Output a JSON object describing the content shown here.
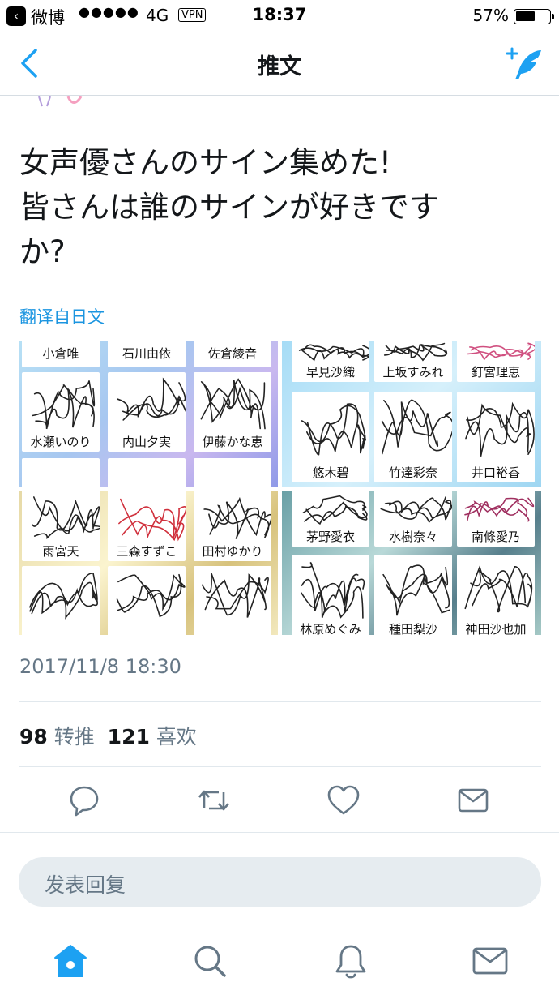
{
  "status_bar": {
    "app_name": "微博",
    "signal": "●●●●●",
    "network": "4G",
    "vpn": "VPN",
    "time": "18:37",
    "battery_percent": "57%",
    "battery_level": 0.57
  },
  "nav": {
    "title": "推文"
  },
  "tweet": {
    "text_lines": [
      "女声優さんのサイン集めた!",
      "皆さんは誰のサインが好きです",
      "か?"
    ],
    "translate_link": "翻译自日文",
    "timestamp": "2017/11/8 18:30",
    "retweet_count": "98",
    "retweet_label": "转推",
    "like_count": "121",
    "like_label": "喜欢"
  },
  "media": {
    "pane1": [
      "小倉唯",
      "石川由依",
      "佐倉綾音",
      "水瀬いのり",
      "内山夕実",
      "伊藤かな恵"
    ],
    "pane2": [
      "早見沙織",
      "上坂すみれ",
      "釘宮理恵",
      "悠木碧",
      "竹達彩奈",
      "井口裕香"
    ],
    "pane3": [
      "雨宮天",
      "三森すずこ",
      "田村ゆかり"
    ],
    "pane4": [
      "茅野愛衣",
      "水樹奈々",
      "南條愛乃",
      "林原めぐみ",
      "種田梨沙",
      "神田沙也加"
    ]
  },
  "reply_box": {
    "placeholder": "发表回复"
  },
  "colors": {
    "accent": "#1da1f2",
    "link": "#1b95e0",
    "icon_gray": "#657786",
    "divider": "#e1e8ed"
  },
  "icons": {
    "actions": [
      "reply-icon",
      "retweet-icon",
      "like-icon",
      "share-message-icon"
    ],
    "tabs": [
      "home-icon",
      "search-icon",
      "notifications-icon",
      "messages-icon"
    ]
  }
}
